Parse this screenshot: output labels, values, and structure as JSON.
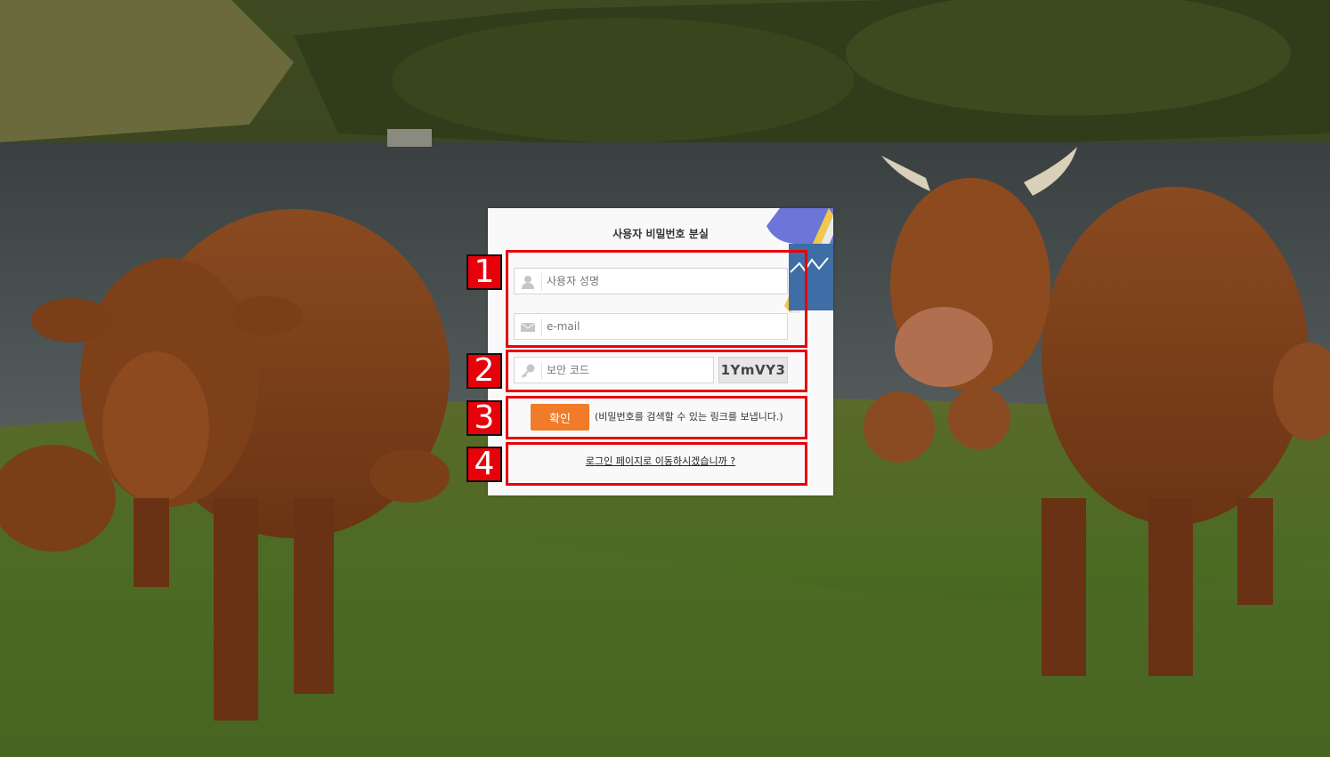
{
  "window": {
    "title": "사용자 비밀번호 분실"
  },
  "form": {
    "name_placeholder": "사용자 성명",
    "email_placeholder": "e-mail",
    "security_placeholder": "보안 코드",
    "captcha_text": "1YmVY3",
    "confirm_label": "확인",
    "confirm_note": "(비밀번호를 검색할 수 있는 링크를 보냅니다.)",
    "login_link": "로그인 페이지로 이동하시겠습니까 ?"
  },
  "annotations": [
    {
      "number": "1",
      "target": "name-and-email-fields"
    },
    {
      "number": "2",
      "target": "security-code-row"
    },
    {
      "number": "3",
      "target": "confirm-row"
    },
    {
      "number": "4",
      "target": "login-link-row"
    }
  ],
  "icons": {
    "name": "user-icon",
    "email": "envelope-icon",
    "security": "key-icon"
  },
  "colors": {
    "highlight": "#e8000b",
    "button": "#f07b28"
  }
}
